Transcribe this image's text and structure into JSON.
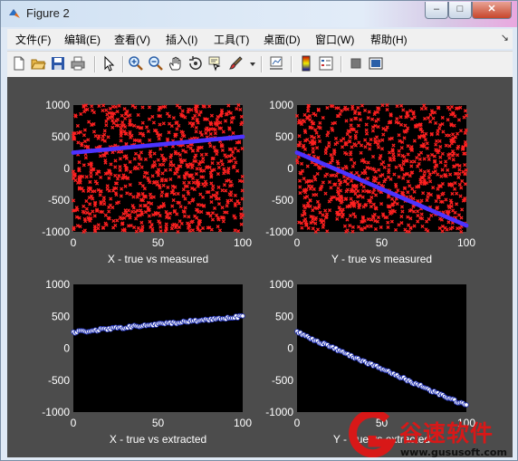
{
  "window": {
    "title": "Figure 2"
  },
  "menu": [
    "文件(F)",
    "编辑(E)",
    "查看(V)",
    "插入(I)",
    "工具(T)",
    "桌面(D)",
    "窗口(W)",
    "帮助(H)"
  ],
  "toolbar_icons": [
    "new-figure-icon",
    "open-file-icon",
    "save-icon",
    "print-icon",
    "pointer-icon",
    "zoom-in-icon",
    "zoom-out-icon",
    "pan-icon",
    "rotate-3d-icon",
    "data-cursor-icon",
    "brush-icon",
    "brush-dropdown-icon",
    "link-plot-icon",
    "colorbar-icon",
    "legend-icon",
    "hide-plot-tools-icon",
    "show-plot-tools-icon"
  ],
  "colors": {
    "figure_bg": "#4c4c4c",
    "axes_bg": "#000000",
    "measured": "#ff2020",
    "fit_line": "#4d33ff",
    "extracted_edge": "#2030b0",
    "extracted_face": "#ffffff",
    "text": "#ffffff"
  },
  "chart_data": [
    {
      "type": "scatter",
      "xlabel": "X - true vs measured",
      "xlim": [
        0,
        100
      ],
      "ylim": [
        -1000,
        1000
      ],
      "xticks": [
        0,
        50,
        100
      ],
      "yticks": [
        1000,
        500,
        0,
        -500,
        -1000
      ],
      "series": [
        {
          "kind": "noise",
          "marker": "x",
          "color": "#ff2020",
          "x_range": [
            0,
            100
          ],
          "y_range": [
            -1000,
            1000
          ]
        },
        {
          "kind": "line",
          "marker": "o",
          "color": "#4d33ff",
          "x": [
            0,
            100
          ],
          "y": [
            250,
            500
          ]
        }
      ]
    },
    {
      "type": "scatter",
      "xlabel": "Y - true vs measured",
      "xlim": [
        0,
        100
      ],
      "ylim": [
        -1000,
        1000
      ],
      "xticks": [
        0,
        50,
        100
      ],
      "yticks": [
        1000,
        500,
        0,
        -500,
        -1000
      ],
      "series": [
        {
          "kind": "noise",
          "marker": "x",
          "color": "#ff2020",
          "x_range": [
            0,
            100
          ],
          "y_range": [
            -1000,
            1000
          ]
        },
        {
          "kind": "line",
          "marker": "o",
          "color": "#4d33ff",
          "x": [
            0,
            100
          ],
          "y": [
            250,
            -900
          ]
        }
      ]
    },
    {
      "type": "scatter",
      "xlabel": "X - true vs extracted",
      "xlim": [
        0,
        100
      ],
      "ylim": [
        -1000,
        1000
      ],
      "xticks": [
        0,
        50,
        100
      ],
      "yticks": [
        1000,
        500,
        0,
        -500,
        -1000
      ],
      "series": [
        {
          "kind": "points",
          "marker": "o",
          "color": "#2030b0",
          "x": [
            0,
            100
          ],
          "y": [
            250,
            500
          ]
        }
      ]
    },
    {
      "type": "scatter",
      "xlabel": "Y - true vs extracted",
      "xlim": [
        0,
        100
      ],
      "ylim": [
        -1000,
        1000
      ],
      "xticks": [
        0,
        50,
        100
      ],
      "yticks": [
        1000,
        500,
        0,
        -500,
        -1000
      ],
      "series": [
        {
          "kind": "points",
          "marker": "o",
          "color": "#2030b0",
          "x": [
            0,
            100
          ],
          "y": [
            250,
            -900
          ]
        }
      ]
    }
  ],
  "watermark": {
    "brand": "谷速软件",
    "url": "www.gususoft.com"
  }
}
